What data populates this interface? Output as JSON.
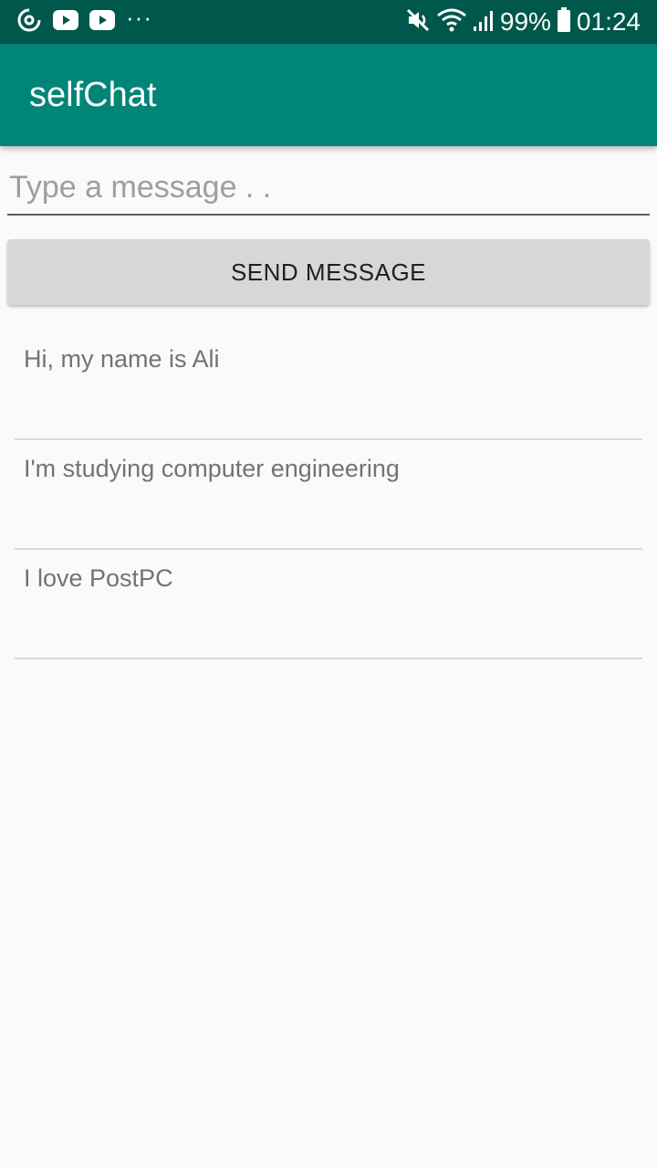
{
  "status_bar": {
    "battery": "99%",
    "time": "01:24",
    "left_icons": [
      "sync-circle-icon",
      "youtube-icon",
      "youtube-icon",
      "more-dots-icon"
    ],
    "right_icons": [
      "mute-icon",
      "wifi-icon",
      "signal-icon",
      "battery-icon"
    ]
  },
  "app_bar": {
    "title": "selfChat"
  },
  "composer": {
    "placeholder": "Type a message . .",
    "value": "",
    "send_label": "SEND MESSAGE"
  },
  "messages": [
    {
      "text": "Hi, my name is Ali"
    },
    {
      "text": "I'm studying computer engineering"
    },
    {
      "text": "I love PostPC"
    }
  ],
  "colors": {
    "status_bar": "#00574b",
    "app_bar": "#008577",
    "background": "#fafafa",
    "button": "#d7d7d7"
  }
}
